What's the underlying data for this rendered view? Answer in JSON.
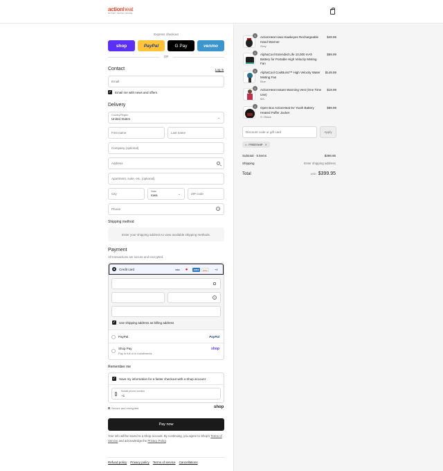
{
  "header": {
    "brand_main": "action",
    "brand_accent": "heat",
    "brand_tagline": "BATTERY HEATED APPAREL",
    "cart_icon": "shopping-bag-icon"
  },
  "express": {
    "title": "Express checkout",
    "buttons": [
      "shop",
      "PayPal",
      "G Pay",
      "venmo"
    ],
    "or": "OR"
  },
  "contact": {
    "heading": "Contact",
    "login": "Log in",
    "email_placeholder": "Email",
    "news_label": "Email me with news and offers"
  },
  "delivery": {
    "heading": "Delivery",
    "country_label": "Country/Region",
    "country_value": "United States",
    "first_name": "First name",
    "last_name": "Last name",
    "company": "Company (optional)",
    "address": "Address",
    "apartment": "Apartment, suite, etc. (optional)",
    "city": "City",
    "state_label": "State",
    "state_value": "Iowa",
    "zip": "ZIP code",
    "phone": "Phone"
  },
  "shipping": {
    "heading": "Shipping method",
    "message": "Enter your shipping address to view available shipping methods."
  },
  "payment": {
    "heading": "Payment",
    "subtitle": "All transactions are secure and encrypted.",
    "credit_card": "Credit card",
    "cards": [
      "VISA",
      "MC",
      "AMEX",
      "DISC"
    ],
    "more_cards": "+4",
    "billing_label": "Use shipping address as billing address",
    "paypal_label": "PayPal",
    "paypal_logo": "PayPal",
    "shoppay_label": "Shop Pay",
    "shoppay_sub": "Pay in full or in installments",
    "shoppay_logo": "shop"
  },
  "remember": {
    "heading": "Remember me",
    "save_label": "Save my information for a faster checkout with a Shop account",
    "phone_label": "Mobile phone number",
    "phone_value": "+1",
    "secure": "Secure and encrypted",
    "shop_logo": "shop"
  },
  "pay_now": "Pay now",
  "legal": {
    "line1": "Your info will be saved to a Shop account. By continuing, you agree to Shop's",
    "tos": "Terms of Service",
    "mid": "and acknowledge the",
    "privacy": "Privacy Policy",
    "end": "."
  },
  "footer": [
    "Refund policy",
    "Privacy policy",
    "Terms of service",
    "Cancellations"
  ],
  "cart": {
    "items": [
      {
        "qty": "1",
        "name": "ActionHeat Iowa Hawkeyes Rechargeable Hand Warmer",
        "variant": "Grey",
        "price": "$49.99"
      },
      {
        "qty": "1",
        "name": "AlphaCool Extended Life 10,000 mAh Battery for Portable High Velocity Misting Fan",
        "variant": "",
        "price": "$89.99"
      },
      {
        "qty": "1",
        "name": "AlphaCool CoolBurst™ High Velocity Water Misting Fan",
        "variant": "Blue",
        "price": "$149.99"
      },
      {
        "qty": "1",
        "name": "ActionHeat Instant Warming Vest (One Time Use)",
        "variant": "M/L",
        "price": "$19.99"
      },
      {
        "qty": "1",
        "name": "Open Box ActionHeat 5V Youth Battery Heated Puffer Jacket",
        "variant": "S / Black",
        "price": "$89.99"
      }
    ],
    "discount_placeholder": "Discount code or gift card",
    "apply": "Apply",
    "code_tag": "FREESHIP",
    "subtotal_label": "Subtotal · 5 items",
    "subtotal_value": "$399.95",
    "shipping_label": "Shipping",
    "shipping_value": "Enter shipping address",
    "total_label": "Total",
    "currency": "USD",
    "total_value": "$399.95"
  }
}
